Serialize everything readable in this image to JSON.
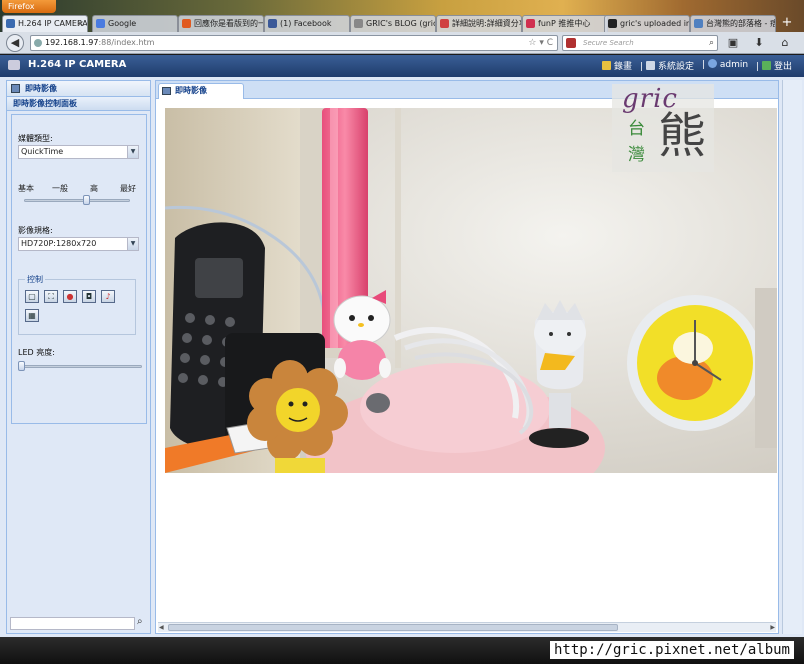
{
  "browser": {
    "menu_label": "Firefox",
    "tabs": [
      {
        "label": "H.264 IP CAMERA",
        "color": "#3a6ab0",
        "active": true
      },
      {
        "label": "Google",
        "color": "#4a7be0",
        "active": false
      },
      {
        "label": "回應你是看版到的一...",
        "color": "#e05a20",
        "active": false
      },
      {
        "label": "(1) Facebook",
        "color": "#3b5998",
        "active": false
      },
      {
        "label": "GRIC's BLOG (gric的...",
        "color": "#888888",
        "active": false
      },
      {
        "label": "詳細說明:詳細資分享...",
        "color": "#d04040",
        "active": false
      },
      {
        "label": "funP 推推中心",
        "color": "#d03050",
        "active": false
      },
      {
        "label": "gric's uploaded im...",
        "color": "#222222",
        "active": false
      },
      {
        "label": "台灣熊的部落格 - 痞...",
        "color": "#5080c0",
        "active": false
      }
    ],
    "url_domain": "192.168.1.97",
    "url_rest": ":88/index.htm",
    "search_placeholder": "Secure Search"
  },
  "app": {
    "title": "H.264 IP CAMERA",
    "menu": {
      "record": "錄畫",
      "settings": "系統設定",
      "user": "admin",
      "logout": "登出"
    }
  },
  "left_panel": {
    "title": "即時影像",
    "subtitle": "即時影像控制面板",
    "player_label": "媒體類型:",
    "player_value": "QuickTime",
    "quality_labels": [
      "基本",
      "一般",
      "高",
      "最好"
    ],
    "quality_level": 0.6,
    "resolution_label": "影像規格:",
    "resolution_value": "HD720P:1280x720",
    "control_label": "控制",
    "led_label": "LED 亮度:",
    "led_level": 0.0
  },
  "main_panel": {
    "tab_label": "即時影像"
  },
  "watermark": {
    "logo_text": "gric",
    "logo_tw_1": "台",
    "logo_tw_2": "灣",
    "logo_bear": "熊",
    "url": "http://gric.pixnet.net/album"
  }
}
